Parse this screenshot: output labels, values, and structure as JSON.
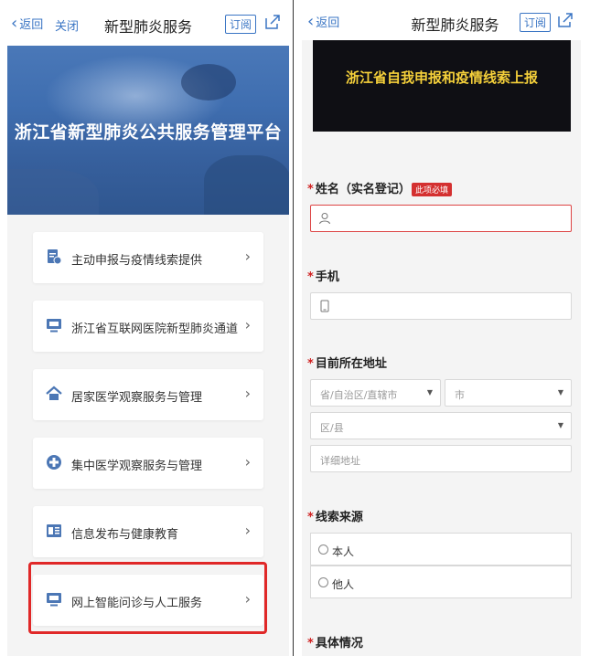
{
  "left": {
    "nav": {
      "back_label": "返回",
      "close_label": "关闭",
      "title": "新型肺炎服务",
      "subscribe_label": "订阅"
    },
    "banner": {
      "title": "浙江省新型肺炎公共服务管理平台"
    },
    "menu": [
      {
        "label": "主动申报与疫情线索提供",
        "icon": "report-doc-icon"
      },
      {
        "label": "浙江省互联网医院新型肺炎通道",
        "icon": "monitor-ai-icon"
      },
      {
        "label": "居家医学观察服务与管理",
        "icon": "home-icon"
      },
      {
        "label": "集中医学观察服务与管理",
        "icon": "medical-cross-icon"
      },
      {
        "label": "信息发布与健康教育",
        "icon": "news-icon"
      },
      {
        "label": "网上智能问诊与人工服务",
        "icon": "monitor-ai-icon"
      }
    ],
    "highlighted_index": 5
  },
  "right": {
    "nav": {
      "back_label": "返回",
      "title": "新型肺炎服务",
      "subscribe_label": "订阅"
    },
    "banner": {
      "title": "浙江省自我申报和疫情线索上报"
    },
    "form": {
      "name_label": "姓名（实名登记）",
      "required_badge": "此项必填",
      "phone_label": "手机",
      "address_label": "目前所在地址",
      "province_placeholder": "省/自治区/直辖市",
      "city_placeholder": "市",
      "district_placeholder": "区/县",
      "detail_placeholder": "详细地址",
      "source_label": "线索来源",
      "source_options": [
        "本人",
        "他人"
      ],
      "detail_label": "具体情况"
    }
  },
  "colors": {
    "accent": "#3a75c4",
    "required": "#d02020",
    "highlight_border": "#e02828",
    "banner_text": "#f5d03a"
  }
}
